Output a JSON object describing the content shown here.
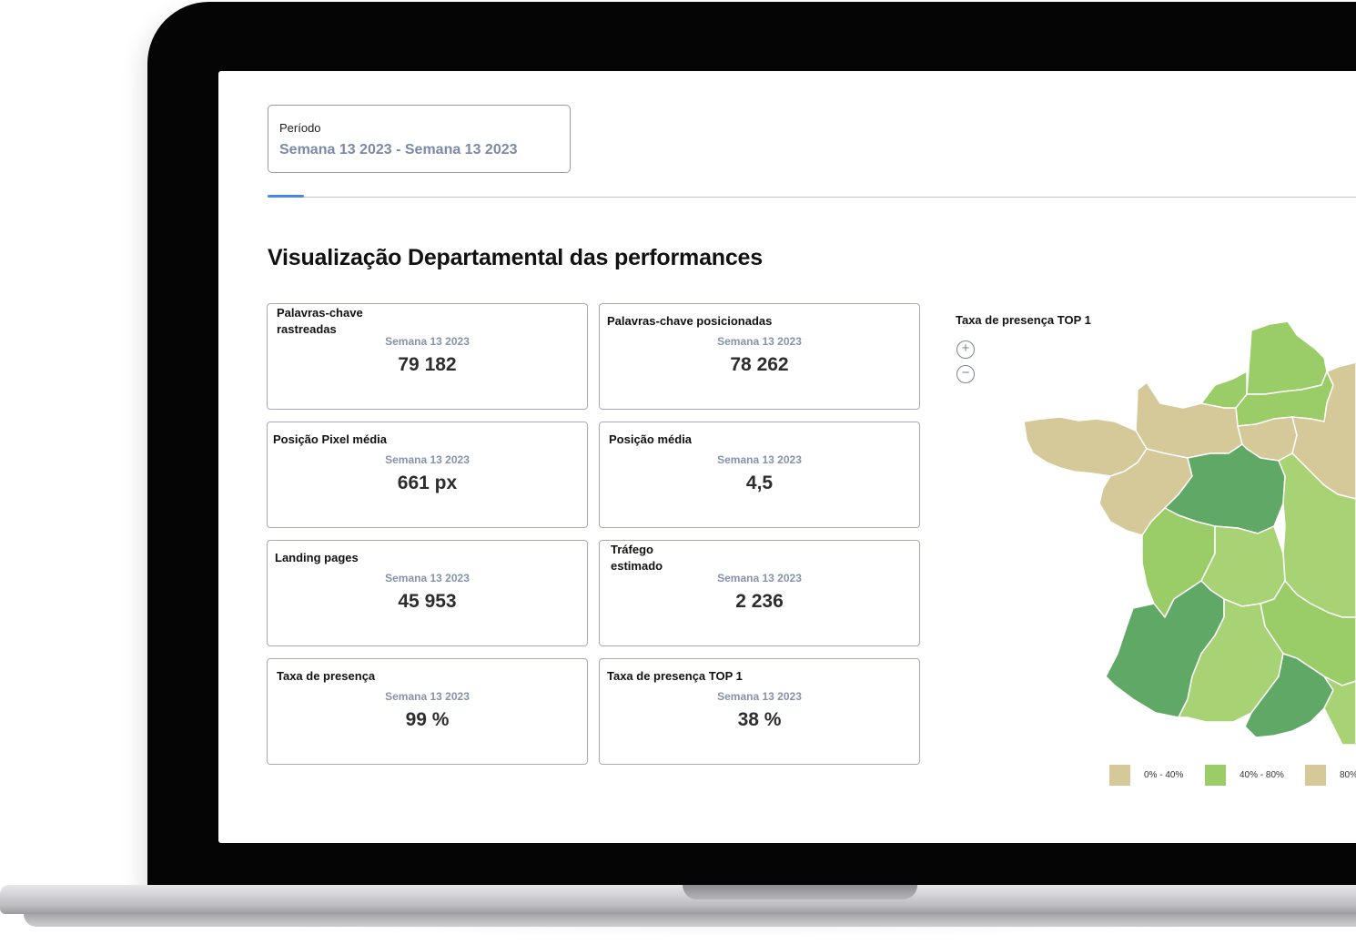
{
  "filter": {
    "period_label": "Período",
    "period_value": "Semana 13 2023 - Semana 13 2023"
  },
  "section": {
    "title": "Visualização Departamental das performances"
  },
  "cards": [
    {
      "title": "Palavras-chave\nrastreadas",
      "period": "Semana 13 2023",
      "value": "79 182"
    },
    {
      "title": "Palavras-chave posicionadas",
      "period": "Semana 13 2023",
      "value": "78 262"
    },
    {
      "title": "Posição Pixel média",
      "period": "Semana 13 2023",
      "value": "661 px"
    },
    {
      "title": "Posição média",
      "period": "Semana 13 2023",
      "value": "4,5"
    },
    {
      "title": "Landing pages",
      "period": "Semana 13 2023",
      "value": "45 953"
    },
    {
      "title": "Tráfego\nestimado",
      "period": "Semana 13 2023",
      "value": "2 236"
    },
    {
      "title": "Taxa de presença",
      "period": "Semana 13 2023",
      "value": "99 %"
    },
    {
      "title": "Taxa de presença TOP 1",
      "period": "Semana 13 2023",
      "value": "38 %"
    }
  ],
  "map": {
    "title": "Taxa de presença TOP 1",
    "zoom_in": "+",
    "zoom_out": "−",
    "legend": [
      {
        "label": "0% - 40%",
        "color": "#d5c99a"
      },
      {
        "label": "40% - 80%",
        "color": "#9acd67"
      },
      {
        "label": "80%",
        "color": "#d5c99a"
      }
    ],
    "colors": {
      "tan": "#d5c99a",
      "light_green": "#9acd67",
      "mid_green": "#a8d374",
      "dark_green": "#5fa866"
    }
  }
}
